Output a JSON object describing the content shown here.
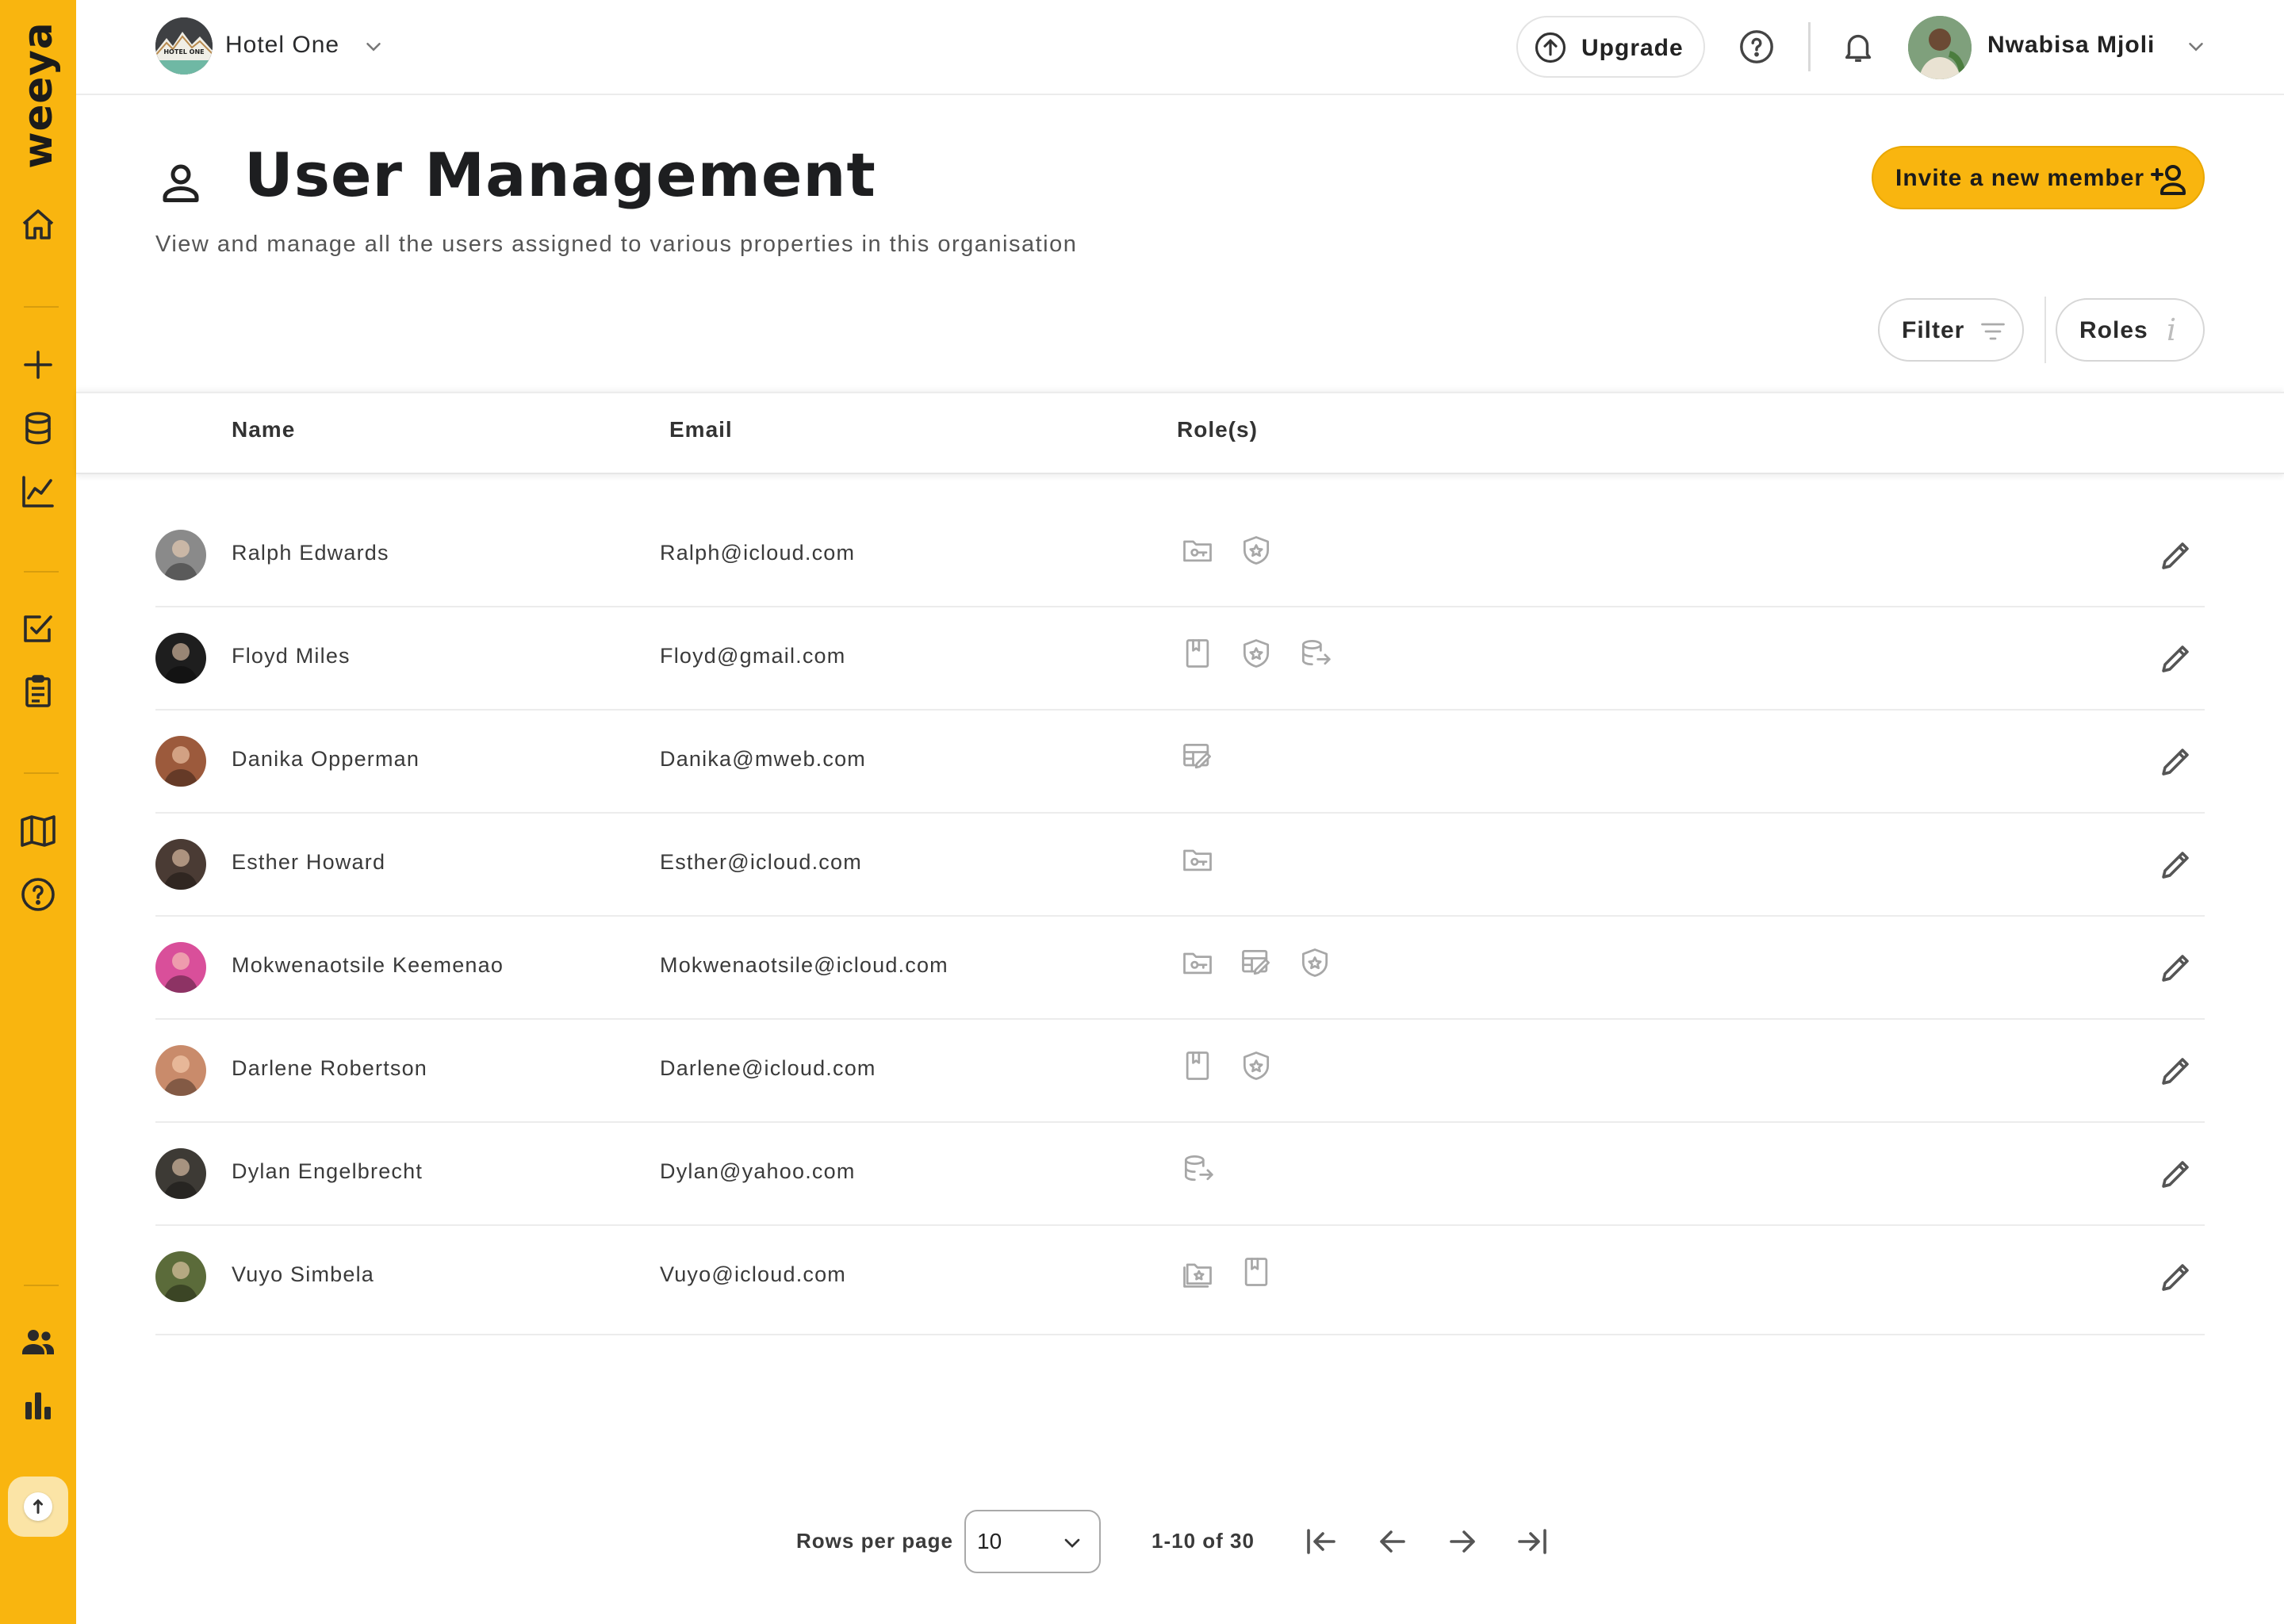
{
  "app": {
    "brand": "weeya",
    "sidebar_icons": [
      "home-icon",
      "plus-icon",
      "database-icon",
      "line-chart-icon",
      "checklist-icon",
      "clipboard-icon",
      "book-icon",
      "help-icon",
      "users-icon",
      "bar-chart-icon",
      "version-icon"
    ],
    "accent_color": "#F9B50F"
  },
  "header": {
    "property_name": "Hotel One",
    "property_logo_text": "HOTEL ONE",
    "upgrade_label": "Upgrade",
    "user_name": "Nwabisa Mjoli"
  },
  "page": {
    "title": "User Management",
    "subtitle": "View and manage all the users assigned to various properties in this organisation",
    "invite_label": "Invite a new member",
    "filter_label": "Filter",
    "roles_label": "Roles",
    "roles_info_glyph": "i"
  },
  "table": {
    "columns": {
      "name": "Name",
      "email": "Email",
      "roles": "Role(s)"
    },
    "rows": [
      {
        "name": "Ralph Edwards",
        "email": "Ralph@icloud.com",
        "avatar_color": "#8a8a8a",
        "roles": [
          "folder-key-icon",
          "shield-star-icon"
        ]
      },
      {
        "name": "Floyd Miles",
        "email": "Floyd@gmail.com",
        "avatar_color": "#1e1e1e",
        "roles": [
          "bookmark-icon",
          "shield-star-icon",
          "database-export-icon"
        ]
      },
      {
        "name": "Danika Opperman",
        "email": "Danika@mweb.com",
        "avatar_color": "#9c5a3c",
        "roles": [
          "table-edit-icon"
        ]
      },
      {
        "name": "Esther Howard",
        "email": "Esther@icloud.com",
        "avatar_color": "#4a3b34",
        "roles": [
          "folder-key-icon"
        ]
      },
      {
        "name": "Mokwenaotsile Keemenao",
        "email": "Mokwenaotsile@icloud.com",
        "avatar_color": "#d94f9a",
        "roles": [
          "folder-key-icon",
          "table-edit-icon",
          "shield-star-icon"
        ]
      },
      {
        "name": "Darlene Robertson",
        "email": "Darlene@icloud.com",
        "avatar_color": "#c98b6b",
        "roles": [
          "bookmark-icon",
          "shield-star-icon"
        ]
      },
      {
        "name": "Dylan Engelbrecht",
        "email": "Dylan@yahoo.com",
        "avatar_color": "#3d3a35",
        "roles": [
          "database-export-icon"
        ]
      },
      {
        "name": "Vuyo Simbela",
        "email": "Vuyo@icloud.com",
        "avatar_color": "#5b6b3a",
        "roles": [
          "folder-star-icon",
          "bookmark-icon"
        ]
      }
    ]
  },
  "pagination": {
    "rows_per_page_label": "Rows per page",
    "rows_per_page_value": "10",
    "range_text": "1-10 of 30"
  }
}
